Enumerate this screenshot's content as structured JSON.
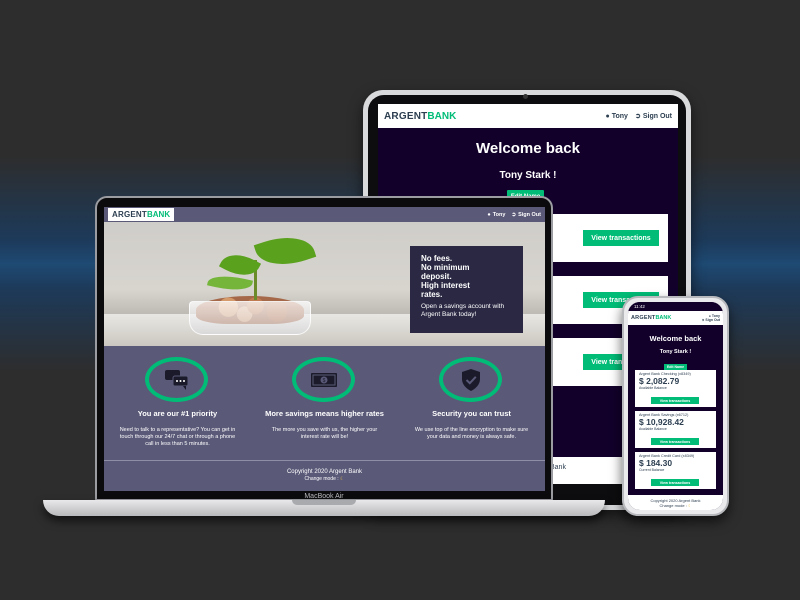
{
  "brand": {
    "part1": "ARGENT",
    "part2": "BANK"
  },
  "colors": {
    "accent": "#00bc77",
    "dark_bg": "#12002b",
    "laptop_bg": "#5a5978",
    "promo_bg": "#2a2843"
  },
  "tablet": {
    "nav": {
      "user": "Tony",
      "sign_out": "Sign Out"
    },
    "title": "Welcome back",
    "user_name": "Tony Stark !",
    "edit_name": "Edit Name",
    "view_transactions": "View transactions",
    "footer_fragment": "Bank"
  },
  "laptop": {
    "nav": {
      "user": "Tony",
      "sign_out": "Sign Out"
    },
    "promo": {
      "lines": [
        "No fees.",
        "No minimum",
        "deposit.",
        "High interest",
        "rates."
      ],
      "text": "Open a savings account with Argent Bank today!"
    },
    "features": [
      {
        "icon": "chat-icon",
        "title": "You are our #1 priority",
        "text": "Need to talk to a representative? You can get in touch through our 24/7 chat or through a phone call in less than 5 minutes."
      },
      {
        "icon": "money-icon",
        "title": "More savings means higher rates",
        "text": "The more you save with us, the higher your interest rate will be!"
      },
      {
        "icon": "shield-icon",
        "title": "Security you can trust",
        "text": "We use top of the line encryption to make sure your data and money is always safe."
      }
    ],
    "footer": {
      "copyright": "Copyright 2020 Argent Bank",
      "change_mode": "Change mode :"
    },
    "model_label": "MacBook Air"
  },
  "phone": {
    "status_time": "11:42",
    "nav": {
      "user": "Tony",
      "sign_out": "Sign Out"
    },
    "title": "Welcome back",
    "user_name": "Tony Stark !",
    "edit_name": "Edit Name",
    "accounts": [
      {
        "title": "Argent Bank Checking (x8349)",
        "amount": "$ 2,082.79",
        "desc": "Available Balance",
        "button": "View transactions"
      },
      {
        "title": "Argent Bank Savings (x6712)",
        "amount": "$ 10,928.42",
        "desc": "Available Balance",
        "button": "View transactions"
      },
      {
        "title": "Argent Bank Credit Card (x8349)",
        "amount": "$ 184.30",
        "desc": "Current Balance",
        "button": "View transactions"
      }
    ],
    "footer": {
      "copyright": "Copyright 2020 Argent Bank",
      "change_mode": "Change mode :"
    }
  }
}
